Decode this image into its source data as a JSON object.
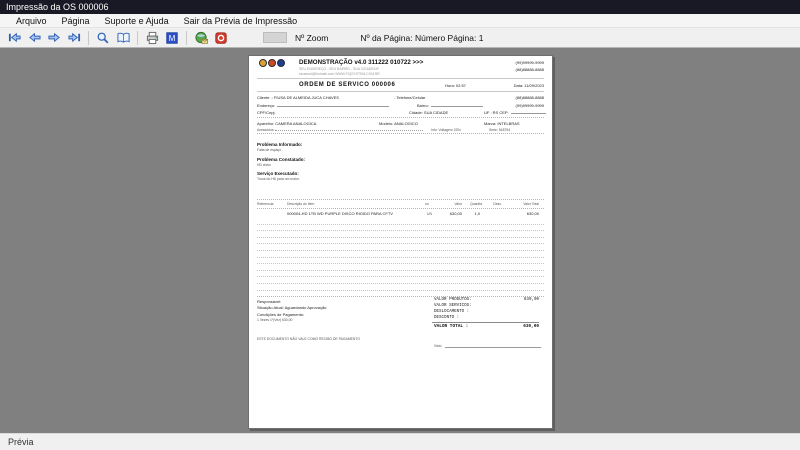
{
  "window": {
    "title": "Impressão da OS 000006"
  },
  "menu": {
    "items": [
      "Arquivo",
      "Página",
      "Suporte e Ajuda",
      "Sair da Prévia de Impressão"
    ]
  },
  "toolbar": {
    "zoom_value": "",
    "zoom_label": "Nº Zoom",
    "page_label": "Nº da Página: Número Página: 1",
    "icons": [
      "first-page-icon",
      "prev-page-icon",
      "next-page-icon",
      "last-page-icon",
      "zoom-icon",
      "two-pages-icon",
      "print-icon",
      "export-word-icon",
      "send-email-icon",
      "pdf-icon"
    ]
  },
  "statusbar": {
    "text": "Prévia"
  },
  "document": {
    "company": {
      "name": "DEMONSTRAÇÃO v4.0 311222 010722 >>>",
      "address": "SEU ENDEREÇO - SEU BAIRRO - SUA CIDADE/UF",
      "contact": "seuemail@hotmail.com   WWW.FIQSYSTEM.COM.BR",
      "phone1": "(99)99999-9999",
      "phone2": "(88)88888-8888"
    },
    "title": "ORDEM DE SERVICO 000006",
    "hora": "Hora: 02:57",
    "data": "Data: 11/09/2023",
    "client": {
      "cliente": "Cliente .: FIUSA DE ALMEIDA JUCA CHAVES",
      "telefone_label": "- Telefone/Celular",
      "telefone": "(88)88888-8888",
      "endereco_label": "Endereço:",
      "bairro_label": "Bairro:",
      "phone2": "(99)99999-9999",
      "cpf_label": "CPF/Cnpj:",
      "cidade": "Cidade: SUA CIDADE",
      "uf_cep": "UF : RS CEP:"
    },
    "device": {
      "aparelho": "Aparelho: CAMERA ANALOGICA",
      "modelo": "Modelo: ANALOGICO",
      "marca": "Marca: INTELBRAS",
      "acessorios": "Acessórios :",
      "info": "Info: Voltagem 220v",
      "serie": "Serie: 548754"
    },
    "problema_informado": {
      "title": "Problema Informado:",
      "text": "Falta de espaço"
    },
    "problema_constatado": {
      "title": "Problema Constatado:",
      "text": "HD cheio"
    },
    "servico_executado": {
      "title": "Serviço Executado:",
      "text": "Troca do HD para um maior."
    },
    "items": {
      "columns": [
        "Referencia",
        "Descrição do Item",
        "un",
        "Valor",
        "Quantia",
        "Desc.",
        "Valor Total"
      ],
      "rows": [
        {
          "desc": "000004-HD 1TB WD PURPLE DISCO RIGIDO PARA CFTV",
          "un": "UN",
          "valor": "630,00",
          "quantia": "1,0",
          "desconto": "",
          "total": "630,00"
        }
      ]
    },
    "footer": {
      "responsavel": "Responsável:",
      "situacao": "Situação Atual: Aguardando Aprovação",
      "condicoes": "Condições de Pagamento:",
      "parcelas": "1 Vezes      1º(Vez)      630,00",
      "totals": [
        {
          "label": "VALOR PRODUTOS:",
          "value": "630,00"
        },
        {
          "label": "VALOR SERVICOS:",
          "value": ""
        },
        {
          "label": "DESLOCAMENTO  :",
          "value": ""
        },
        {
          "label": "DESCONTO      :",
          "value": ""
        }
      ],
      "total_label": "VALOR TOTAL   :",
      "total_value": "630,00",
      "disclaimer": "ESTE DOCUMENTO NÃO VALE COMO RECIBO DE PAGAMENTO",
      "visto_label": "Visto"
    }
  }
}
